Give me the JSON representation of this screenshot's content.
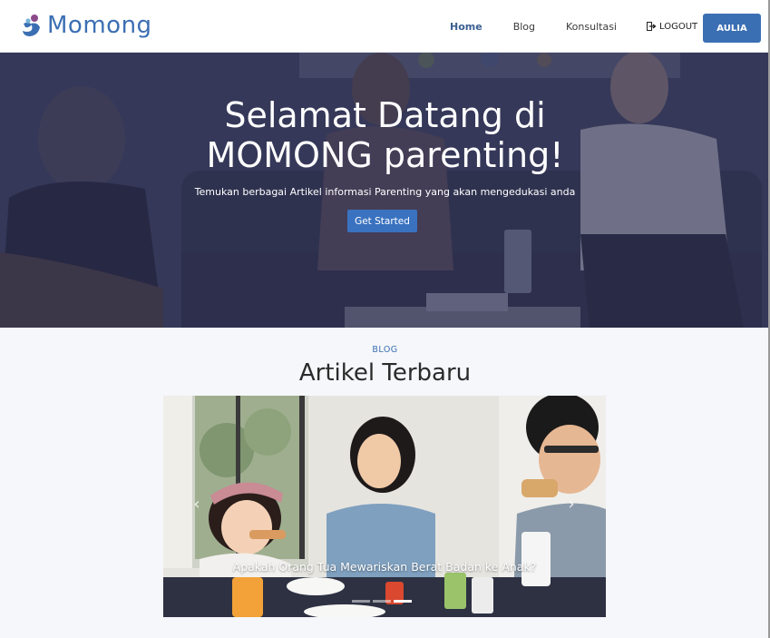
{
  "navbar": {
    "brand_name": "Momong",
    "links": [
      "Home",
      "Blog",
      "Konsultasi"
    ],
    "logout_label": "LOGOUT",
    "user_label": "AULIA"
  },
  "hero": {
    "title_line1": "Selamat Datang di",
    "title_line2": "MOMONG parenting!",
    "subtitle": "Temukan berbagai Artikel informasi Parenting yang akan mengedukasi anda",
    "cta_label": "Get Started"
  },
  "blog": {
    "eyebrow": "BLOG",
    "heading": "Artikel Terbaru",
    "carousel": {
      "caption": "Apakah Orang Tua Mewariskan Berat Badan ke Anak?",
      "slide_count": 3,
      "active_slide": 3
    }
  },
  "colors": {
    "brand": "#3b6fb3",
    "hero_overlay": "#242648",
    "button": "#3a72c0"
  }
}
